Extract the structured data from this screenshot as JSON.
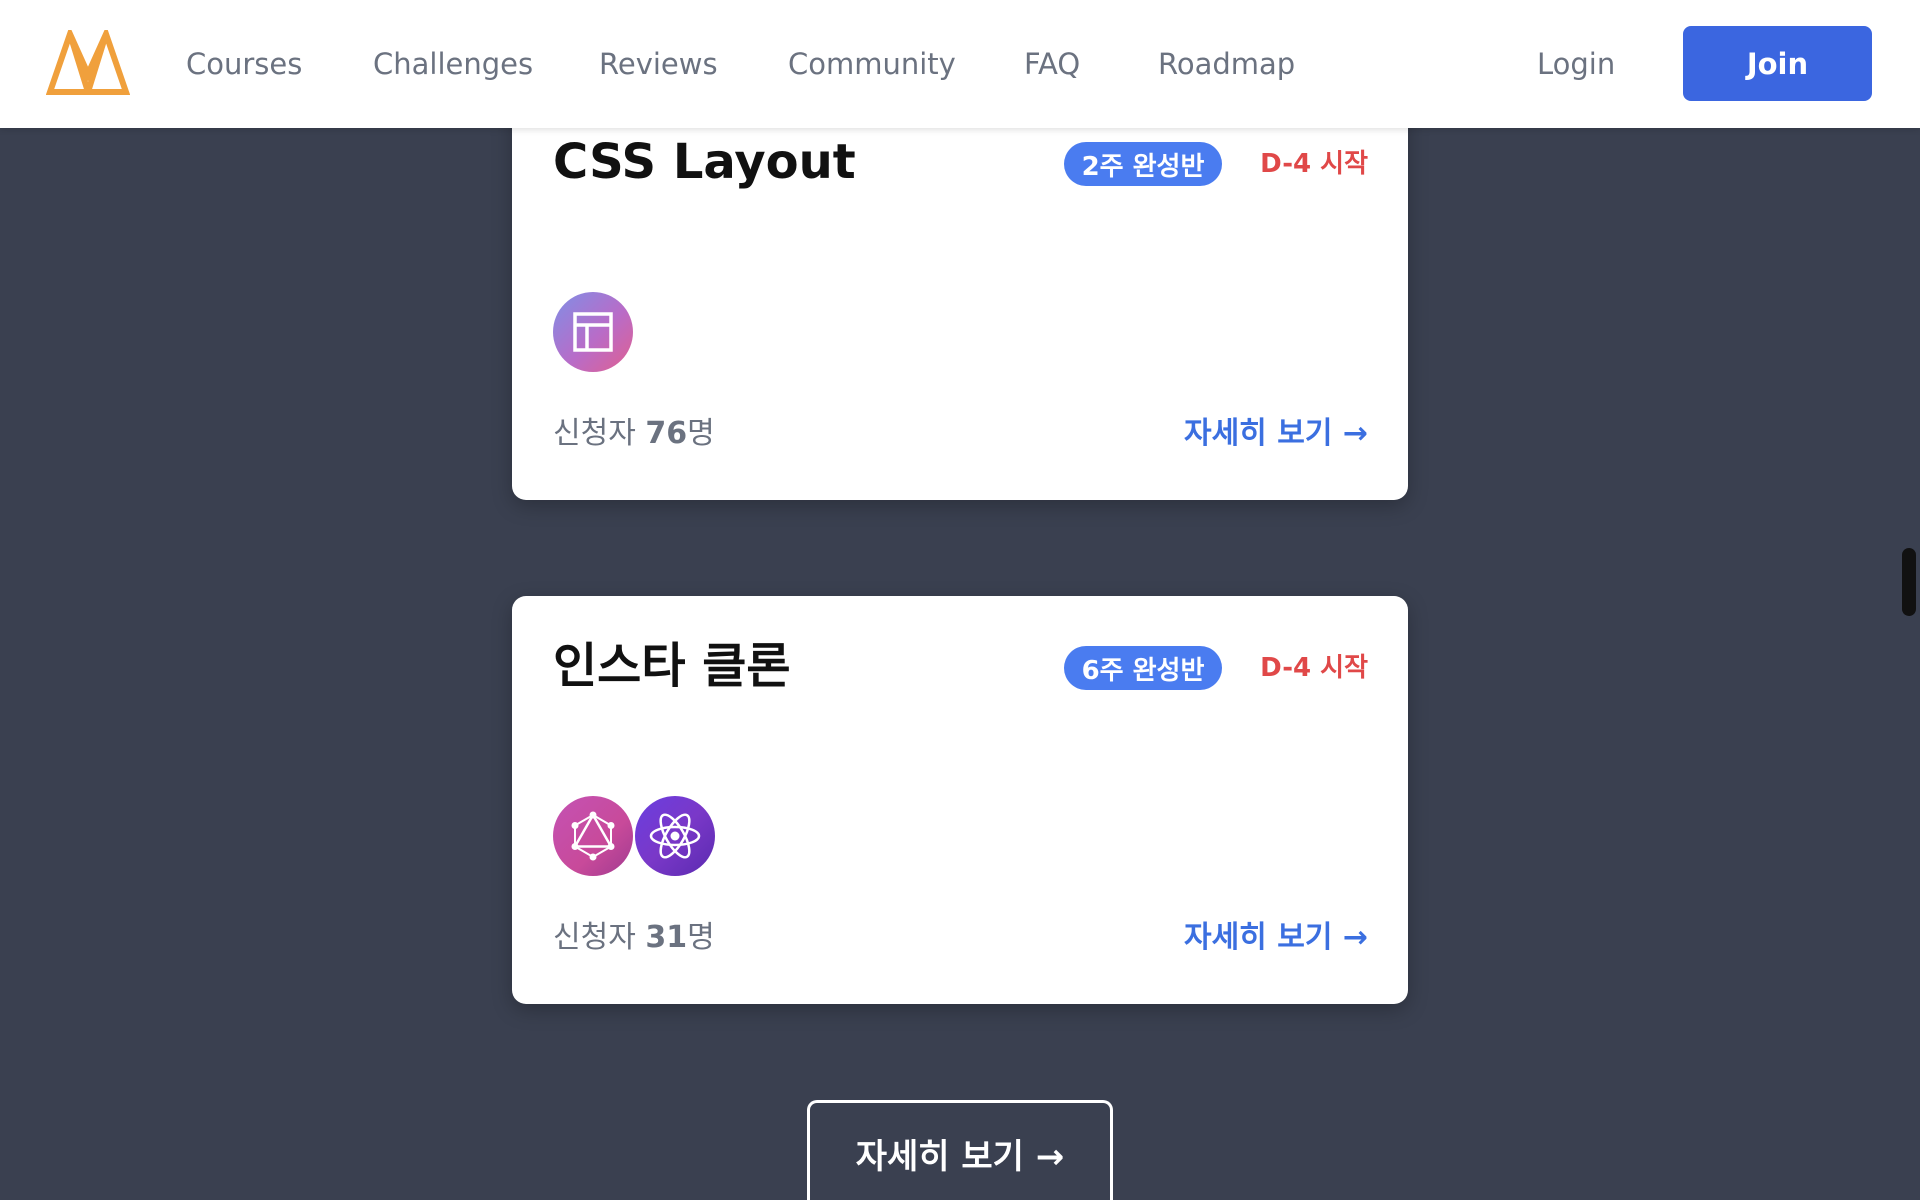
{
  "header": {
    "logo": "logo-icon",
    "nav": [
      "Courses",
      "Challenges",
      "Reviews",
      "Community",
      "FAQ",
      "Roadmap"
    ],
    "login_label": "Login",
    "join_label": "Join"
  },
  "cards": [
    {
      "title": "CSS Layout",
      "badge": "2주 완성반",
      "dday": "D-4 시작",
      "icons": [
        "layout-icon"
      ],
      "applicants_prefix": "신청자 ",
      "applicants_count": "76",
      "applicants_suffix": "명",
      "detail_link": "자세히 보기 →"
    },
    {
      "title": "인스타 클론",
      "badge": "6주 완성반",
      "dday": "D-4 시작",
      "icons": [
        "graphql-icon",
        "react-icon"
      ],
      "applicants_prefix": "신청자 ",
      "applicants_count": "31",
      "applicants_suffix": "명",
      "detail_link": "자세히 보기 →"
    }
  ],
  "more_button_label": "자세히 보기 →",
  "colors": {
    "background": "#3a4050",
    "primary": "#3b66e0",
    "badge": "#4a7cf0",
    "dday": "#e04848",
    "logo": "#f0a03c"
  }
}
